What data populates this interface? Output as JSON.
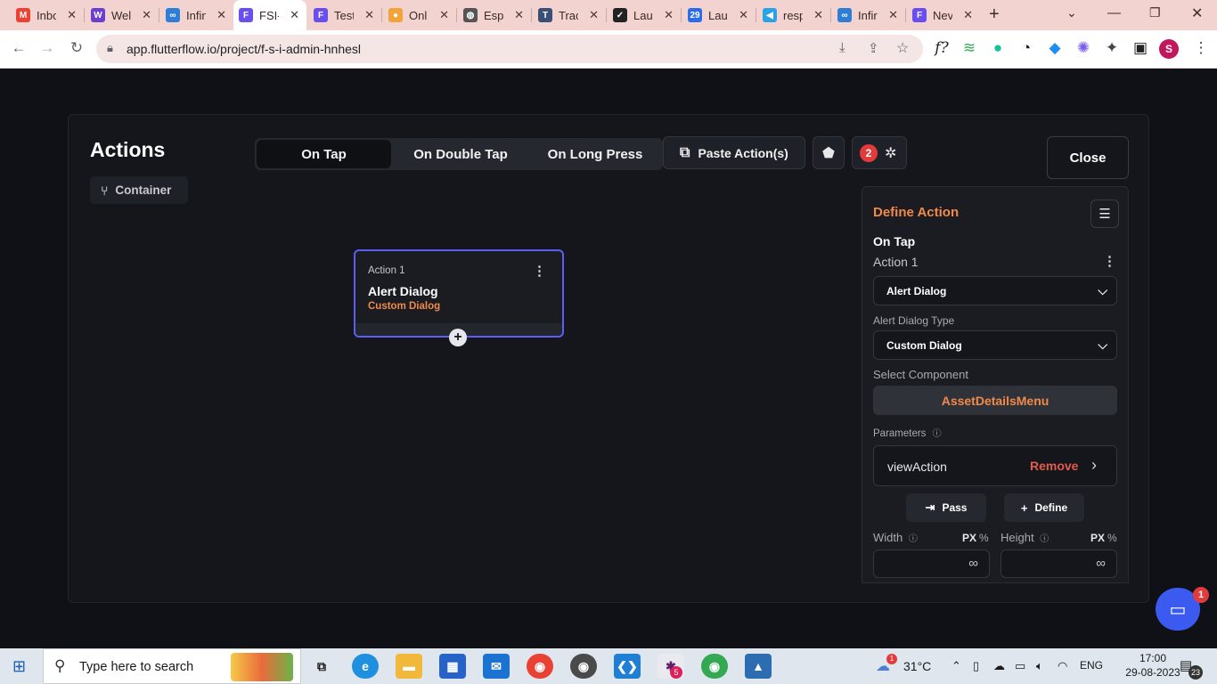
{
  "browser": {
    "tabs": [
      {
        "label": "Inbox",
        "icon": "gmail-icon",
        "color": "#ea4335"
      },
      {
        "label": "Welcome",
        "icon": "w-icon",
        "color": "#6a3fd1"
      },
      {
        "label": "Infinity",
        "icon": "link-icon",
        "color": "#2e7dd6"
      },
      {
        "label": "FSI-",
        "icon": "flutterflow-icon",
        "color": "#6b4ef0"
      },
      {
        "label": "Test",
        "icon": "flutterflow-icon",
        "color": "#6b4ef0"
      },
      {
        "label": "Onl",
        "icon": "drop-icon",
        "color": "#f2a43a"
      },
      {
        "label": "Esp",
        "icon": "globe-icon",
        "color": "#555"
      },
      {
        "label": "Trac",
        "icon": "track-icon",
        "color": "#3b4e73"
      },
      {
        "label": "Lau",
        "icon": "check-icon",
        "color": "#222"
      },
      {
        "label": "Lau",
        "icon": "calendar-icon",
        "color": "#2b6de8"
      },
      {
        "label": "resp",
        "icon": "flutter-icon",
        "color": "#29a3e6"
      },
      {
        "label": "Infir",
        "icon": "link-icon",
        "color": "#2e7dd6"
      },
      {
        "label": "Nev",
        "icon": "flutterflow-icon",
        "color": "#6b4ef0"
      }
    ],
    "url": "app.flutterflow.io/project/f-s-i-admin-hnhesl",
    "profile_initial": "S"
  },
  "modal": {
    "title": "Actions",
    "widget_chip": "Container",
    "triggers": [
      "On Tap",
      "On Double Tap",
      "On Long Press"
    ],
    "selected_trigger": "On Tap",
    "paste_label": "Paste Action(s)",
    "error_count": "2",
    "close_label": "Close"
  },
  "action_card": {
    "label": "Action 1",
    "name": "Alert Dialog",
    "subtype": "Custom Dialog"
  },
  "panel": {
    "title": "Define Action",
    "trigger": "On Tap",
    "action_label": "Action 1",
    "action_type": "Alert Dialog",
    "dialog_type_label": "Alert Dialog Type",
    "dialog_type": "Custom Dialog",
    "component_label": "Select Component",
    "component": "AssetDetailsMenu",
    "parameters_label": "Parameters",
    "param_name": "viewAction",
    "remove_label": "Remove",
    "pass_label": "Pass",
    "define_label": "Define",
    "width_label": "Width",
    "height_label": "Height",
    "unit_px": "PX",
    "unit_pct": "%",
    "width_value": "∞",
    "height_value": "∞"
  },
  "chat_badge": "1",
  "taskbar": {
    "search_placeholder": "Type here to search",
    "temperature": "31°C",
    "language": "ENG",
    "time": "17:00",
    "date": "29-08-2023",
    "notifications": "23",
    "weather_badge": "1",
    "slack_badge": "5"
  },
  "colors": {
    "accent": "#f08a4b",
    "selection": "#5b5ef0",
    "danger": "#e25b4b"
  }
}
